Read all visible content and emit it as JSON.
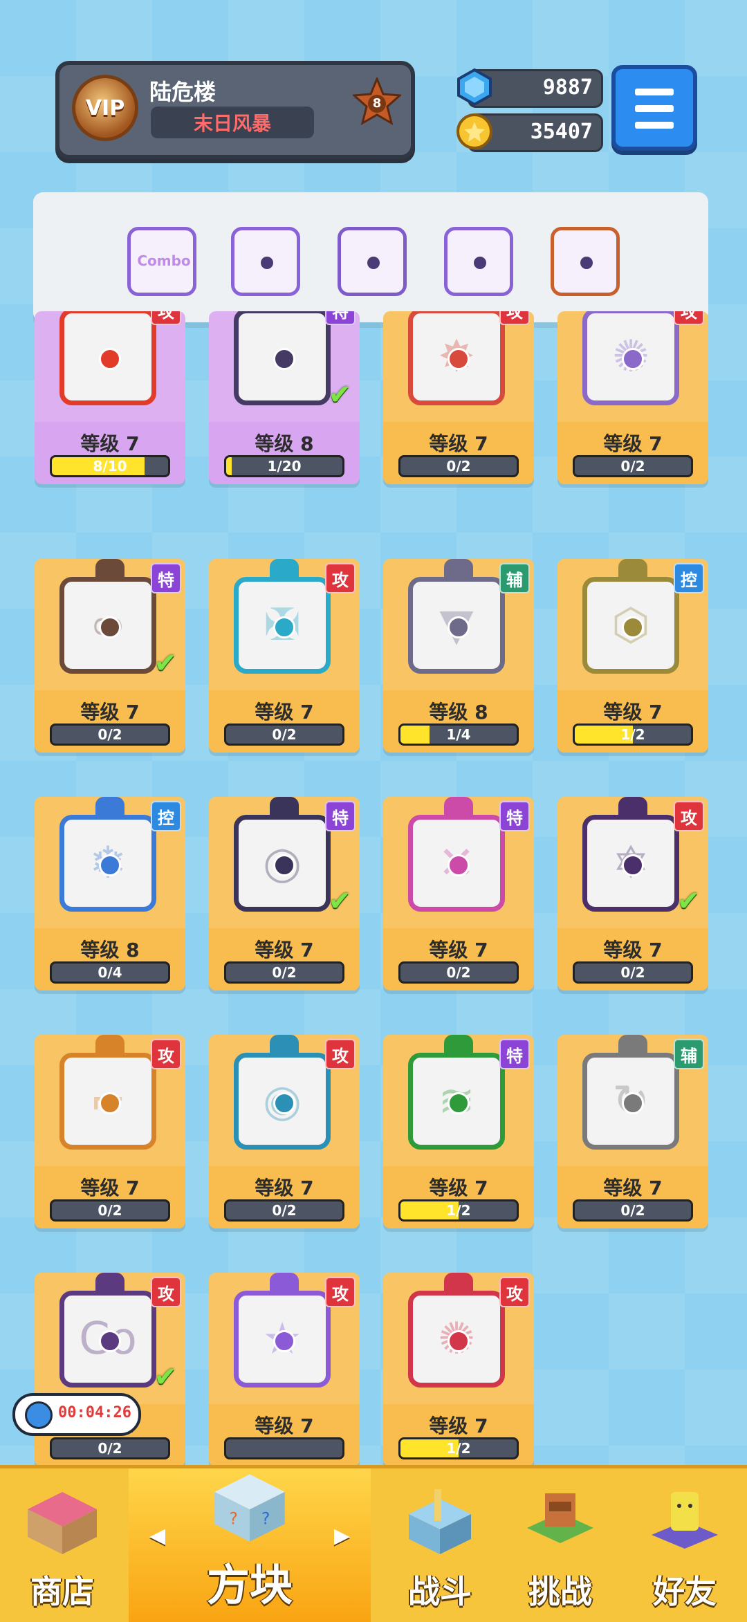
{
  "header": {
    "vip_label": "VIP",
    "player_name": "陆危楼",
    "title_badge": "末日风暴",
    "level": "8",
    "gems": "9887",
    "coins": "35407"
  },
  "equipped": [
    {
      "name": "combo-block",
      "text": "Combo"
    },
    {
      "name": "orbit-block",
      "text": ""
    },
    {
      "name": "crack-block",
      "text": ""
    },
    {
      "name": "orbit-block-2",
      "text": ""
    },
    {
      "name": "infinity-block",
      "text": ""
    }
  ],
  "cards": [
    {
      "level": "等级 7",
      "progress": "8/10",
      "fill": 0.8,
      "tag": "攻",
      "tag_type": "atk",
      "frame": "#e23b2a",
      "glyph": "",
      "purple": true,
      "check": false
    },
    {
      "level": "等级 8",
      "progress": "1/20",
      "fill": 0.05,
      "tag": "特",
      "tag_type": "spc",
      "frame": "#443a63",
      "glyph": "",
      "purple": true,
      "check": true
    },
    {
      "level": "等级 7",
      "progress": "0/2",
      "fill": 0,
      "tag": "攻",
      "tag_type": "atk",
      "frame": "#d84a3c",
      "glyph": "✸",
      "purple": false,
      "check": false
    },
    {
      "level": "等级 7",
      "progress": "0/2",
      "fill": 0,
      "tag": "攻",
      "tag_type": "atk",
      "frame": "#8a69c9",
      "glyph": "✺",
      "purple": false,
      "check": false
    },
    {
      "level": "等级 7",
      "progress": "0/2",
      "fill": 0,
      "tag": "特",
      "tag_type": "spc",
      "frame": "#6b4a3a",
      "glyph": "∞",
      "purple": false,
      "check": true
    },
    {
      "level": "等级 7",
      "progress": "0/2",
      "fill": 0,
      "tag": "攻",
      "tag_type": "atk",
      "frame": "#2aa9c8",
      "glyph": "✠",
      "purple": false,
      "check": false
    },
    {
      "level": "等级 8",
      "progress": "1/4",
      "fill": 0.25,
      "tag": "辅",
      "tag_type": "sup",
      "frame": "#6e6a8a",
      "glyph": "▼",
      "purple": false,
      "check": false
    },
    {
      "level": "等级 7",
      "progress": "1/2",
      "fill": 0.5,
      "tag": "控",
      "tag_type": "ctl",
      "frame": "#9a8a3a",
      "glyph": "⬡",
      "purple": false,
      "check": false
    },
    {
      "level": "等级 8",
      "progress": "0/4",
      "fill": 0,
      "tag": "控",
      "tag_type": "ctl",
      "frame": "#3b7ad6",
      "glyph": "❄",
      "purple": false,
      "check": false
    },
    {
      "level": "等级 7",
      "progress": "0/2",
      "fill": 0,
      "tag": "特",
      "tag_type": "spc",
      "frame": "#3a335a",
      "glyph": "◎",
      "purple": false,
      "check": true
    },
    {
      "level": "等级 7",
      "progress": "0/2",
      "fill": 0,
      "tag": "特",
      "tag_type": "spc",
      "frame": "#cc4aa8",
      "glyph": "✕",
      "purple": false,
      "check": false
    },
    {
      "level": "等级 7",
      "progress": "0/2",
      "fill": 0,
      "tag": "攻",
      "tag_type": "atk",
      "frame": "#4a2f6a",
      "glyph": "✡",
      "purple": false,
      "check": true
    },
    {
      "level": "等级 7",
      "progress": "0/2",
      "fill": 0,
      "tag": "攻",
      "tag_type": "atk",
      "frame": "#d7832a",
      "glyph": "⌐",
      "purple": false,
      "check": false
    },
    {
      "level": "等级 7",
      "progress": "0/2",
      "fill": 0,
      "tag": "攻",
      "tag_type": "atk",
      "frame": "#2b8fb6",
      "glyph": "◉",
      "purple": false,
      "check": false
    },
    {
      "level": "等级 7",
      "progress": "1/2",
      "fill": 0.5,
      "tag": "特",
      "tag_type": "spc",
      "frame": "#2f9a3a",
      "glyph": "≋",
      "purple": false,
      "check": false
    },
    {
      "level": "等级 7",
      "progress": "0/2",
      "fill": 0,
      "tag": "辅",
      "tag_type": "sup",
      "frame": "#7a7a7a",
      "glyph": "↻",
      "purple": false,
      "check": false
    },
    {
      "level": "等级 7",
      "progress": "0/2",
      "fill": 0,
      "tag": "攻",
      "tag_type": "atk",
      "frame": "#5c3a80",
      "glyph": "Co",
      "purple": false,
      "check": true
    },
    {
      "level": "等级 7",
      "progress": "",
      "fill": 0,
      "tag": "攻",
      "tag_type": "atk",
      "frame": "#8b5ad7",
      "glyph": "★",
      "purple": false,
      "check": false
    },
    {
      "level": "等级 7",
      "progress": "1/2",
      "fill": 0.5,
      "tag": "攻",
      "tag_type": "atk",
      "frame": "#d2364a",
      "glyph": "✺",
      "purple": false,
      "check": false
    }
  ],
  "timer": "00:04:26",
  "nav": {
    "shop": "商店",
    "blocks": "方块",
    "battle": "战斗",
    "challenge": "挑战",
    "friends": "好友"
  }
}
